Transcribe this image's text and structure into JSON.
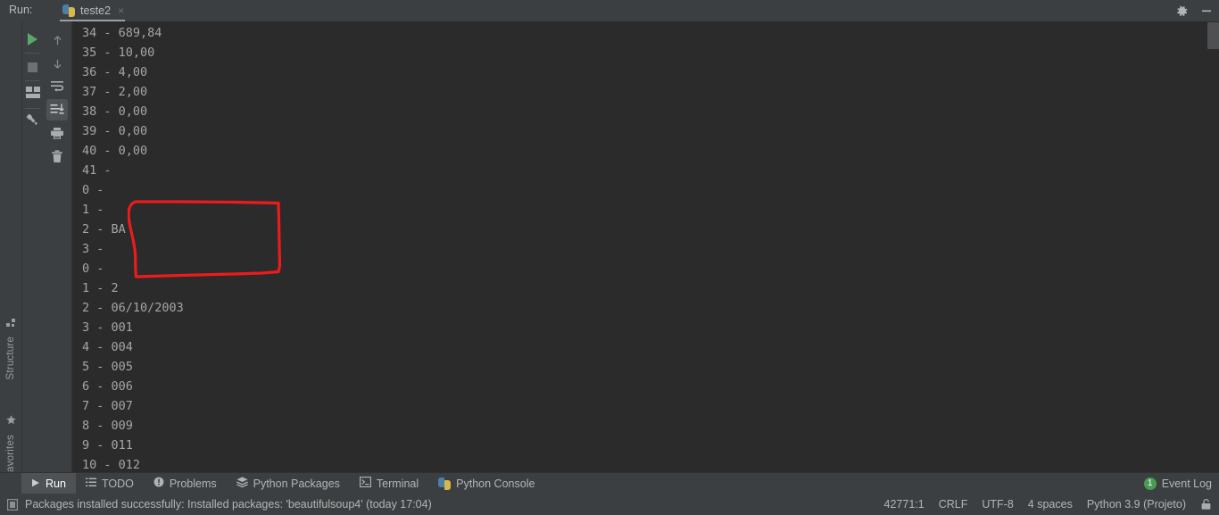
{
  "header": {
    "run_label": "Run:",
    "tab": {
      "title": "teste2",
      "icon": "python-icon",
      "close": "×"
    },
    "settings_icon": "gear-icon",
    "minimize_icon": "minimize-icon"
  },
  "left_rail": {
    "tabs": [
      {
        "label": "Structure",
        "icon": "structure-icon"
      },
      {
        "label": "Favorites",
        "icon": "star-icon"
      }
    ]
  },
  "run_toolbar": {
    "primary": [
      {
        "name": "rerun-button",
        "icon": "play-icon"
      },
      {
        "name": "stop-button",
        "icon": "stop-icon"
      },
      {
        "name": "layout-button",
        "icon": "layout-icon"
      },
      {
        "name": "pin-tab-button",
        "icon": "pin-icon"
      }
    ],
    "secondary": [
      {
        "name": "up-the-stack-button",
        "icon": "arrow-up-icon",
        "selected": false
      },
      {
        "name": "down-the-stack-button",
        "icon": "arrow-down-icon",
        "selected": false
      },
      {
        "name": "soft-wrap-button",
        "icon": "soft-wrap-icon",
        "selected": false
      },
      {
        "name": "scroll-to-end-button",
        "icon": "scroll-to-end-icon",
        "selected": true
      },
      {
        "name": "print-button",
        "icon": "print-icon",
        "selected": false
      },
      {
        "name": "clear-all-button",
        "icon": "trash-icon",
        "selected": false
      }
    ]
  },
  "console": {
    "lines": [
      "34 - 689,84",
      "35 - 10,00",
      "36 - 4,00",
      "37 - 2,00",
      "38 - 0,00",
      "39 - 0,00",
      "40 - 0,00",
      "41 - ",
      "0 - ",
      "1 - ",
      "2 - BA",
      "3 - ",
      "0 - ",
      "1 - 2",
      "2 - 06/10/2003",
      "3 - 001",
      "4 - 004",
      "5 - 005",
      "6 - 006",
      "7 - 007",
      "8 - 009",
      "9 - 011",
      "10 - 012"
    ],
    "annotation": {
      "name": "red-highlight-rectangle",
      "color": "#ee1b1b",
      "encircles": [
        "0 - ",
        "1 - ",
        "2 - BA",
        "3 - "
      ]
    }
  },
  "bottom_tool_window_bar": {
    "items": [
      {
        "label": "Run",
        "icon": "play-icon",
        "active": true
      },
      {
        "label": "TODO",
        "icon": "list-icon",
        "active": false
      },
      {
        "label": "Problems",
        "icon": "warning-icon",
        "active": false
      },
      {
        "label": "Python Packages",
        "icon": "packages-icon",
        "active": false
      },
      {
        "label": "Terminal",
        "icon": "terminal-icon",
        "active": false
      },
      {
        "label": "Python Console",
        "icon": "python-console-icon",
        "active": false
      }
    ],
    "event_log": {
      "label": "Event Log",
      "count": "1",
      "badge_color": "#499c54"
    }
  },
  "status_bar": {
    "message": "Packages installed successfully: Installed packages: 'beautifulsoup4' (today 17:04)",
    "message_icon": "document-icon",
    "caret_position": "42771:1",
    "line_separator": "CRLF",
    "encoding": "UTF-8",
    "indent": "4 spaces",
    "interpreter": "Python 3.9 (Projeto)",
    "lock_icon": "lock-icon"
  },
  "colors": {
    "window_bg": "#3c3f41",
    "console_bg": "#2b2b2b",
    "console_text": "#a3a6a8",
    "accent_green": "#59a869",
    "annotation_red": "#ee1b1b",
    "selected_bg": "#4e5254"
  }
}
